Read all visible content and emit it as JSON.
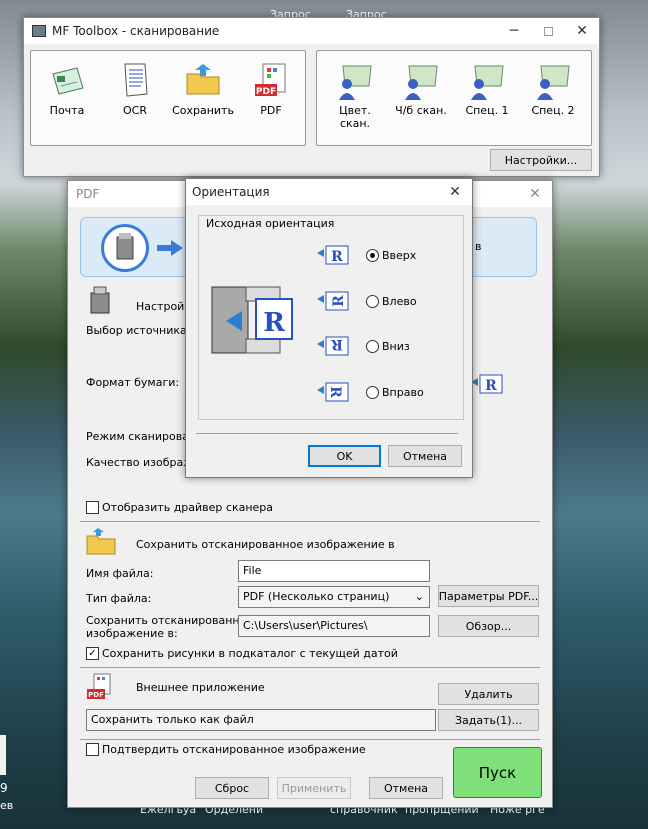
{
  "desktop": {
    "top_items": [
      "Запрос",
      "Запрос"
    ],
    "bottom_items": [
      "Ежелгьуа",
      "Орделени",
      "справочник",
      "пропрщении",
      "Ноже рге"
    ],
    "left_edge": [
      "9",
      "ев"
    ]
  },
  "toolbox": {
    "title": "MF Toolbox - сканирование",
    "tools": [
      {
        "label": "Почта",
        "icon": "mail-icon"
      },
      {
        "label": "OCR",
        "icon": "ocr-document-icon"
      },
      {
        "label": "Сохранить",
        "icon": "folder-save-icon"
      },
      {
        "label": "PDF",
        "icon": "pdf-icon"
      }
    ],
    "scan_buttons": [
      {
        "label": "Цвет. скан.",
        "icon": "scanner-user-icon"
      },
      {
        "label": "Ч/б скан.",
        "icon": "scanner-user-icon"
      },
      {
        "label": "Спец. 1",
        "icon": "scanner-user-icon"
      },
      {
        "label": "Спец. 2",
        "icon": "scanner-user-icon"
      }
    ],
    "settings_label": "Настройки..."
  },
  "pdf": {
    "title": "PDF",
    "banner_tail": "в",
    "settings_partial": "Настрой",
    "source_label": "Выбор источника:",
    "paper_label": "Формат бумаги:",
    "scan_mode_label": "Режим сканирован",
    "quality_label": "Качество изображе",
    "show_driver_label": "Отобразить драйвер сканера",
    "save_heading": "Сохранить отсканированное изображение в",
    "filename_label": "Имя файла:",
    "filename_value": "File",
    "filetype_label": "Тип файла:",
    "filetype_value": "PDF (Несколько страниц)",
    "pdf_params_label": "Параметры PDF...",
    "save_to_label_1": "Сохранить отсканированное",
    "save_to_label_2": "изображение в:",
    "save_path": "C:\\Users\\user\\Pictures\\",
    "browse_label": "Обзор...",
    "subfolder_label": "Сохранить рисунки в подкаталог с текущей датой",
    "external_app_label": "Внешнее приложение",
    "delete_label": "Удалить",
    "external_app_value": "Сохранить только как файл",
    "assign_label": "Задать(1)...",
    "confirm_label": "Подтвердить отсканированное изображение",
    "reset_label": "Сброс",
    "apply_label": "Применить",
    "cancel_label": "Отмена",
    "start_label": "Пуск"
  },
  "orientation": {
    "title": "Ориентация",
    "group_label": "Исходная ориентация",
    "options": [
      {
        "label": "Вверх",
        "selected": true
      },
      {
        "label": "Влево",
        "selected": false
      },
      {
        "label": "Вниз",
        "selected": false
      },
      {
        "label": "Вправо",
        "selected": false
      }
    ],
    "ok_label": "OK",
    "cancel_label": "Отмена"
  },
  "colors": {
    "start_green": "#7fe07a",
    "accent_blue": "#0078d7"
  }
}
